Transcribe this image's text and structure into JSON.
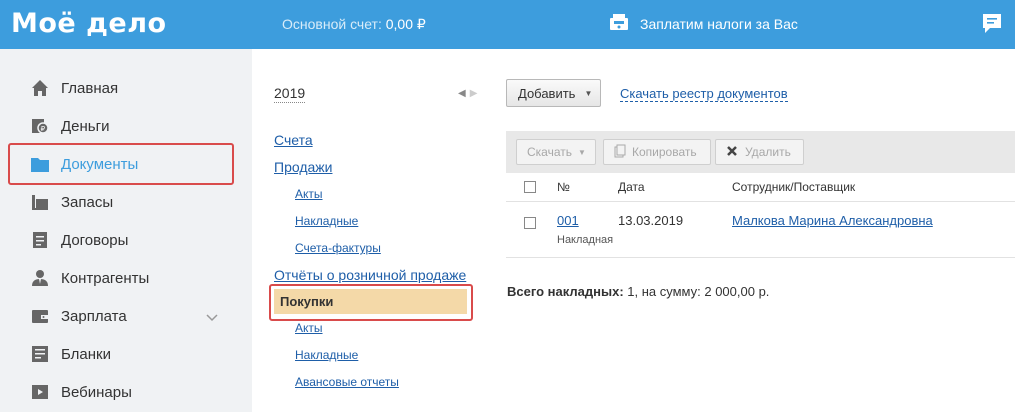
{
  "header": {
    "logo": "Моё дело",
    "account_label": "Основной счет:",
    "account_value": "0,00 ₽",
    "taxes_label": "Заплатим налоги за Вас"
  },
  "sidebar": {
    "items": [
      {
        "label": "Главная",
        "icon": "home-icon"
      },
      {
        "label": "Деньги",
        "icon": "money-icon"
      },
      {
        "label": "Документы",
        "icon": "folder-icon",
        "active": true
      },
      {
        "label": "Запасы",
        "icon": "stock-icon"
      },
      {
        "label": "Договоры",
        "icon": "contract-icon"
      },
      {
        "label": "Контрагенты",
        "icon": "contractor-icon"
      },
      {
        "label": "Зарплата",
        "icon": "wallet-icon"
      },
      {
        "label": "Бланки",
        "icon": "forms-icon"
      },
      {
        "label": "Вебинары",
        "icon": "webinar-icon"
      }
    ]
  },
  "tree": {
    "year": "2019",
    "items": {
      "invoices": "Счета",
      "sales": "Продажи",
      "sales_acts": "Акты",
      "sales_waybills": "Накладные",
      "sales_invoices": "Счета-фактуры",
      "retail_reports": "Отчёты о розничной продаже",
      "purchases": "Покупки",
      "purchase_acts": "Акты",
      "purchase_waybills": "Накладные",
      "advance_reports": "Авансовые отчеты"
    }
  },
  "toolbar": {
    "add_label": "Добавить",
    "download_registry": "Скачать реестр документов",
    "download_label": "Скачать",
    "copy_label": "Копировать",
    "delete_label": "Удалить"
  },
  "table": {
    "headers": {
      "number": "№",
      "date": "Дата",
      "employee": "Сотрудник/Поставщик"
    },
    "rows": [
      {
        "number": "001",
        "type": "Накладная",
        "date": "13.03.2019",
        "supplier": "Малкова Марина Александровна"
      }
    ]
  },
  "summary": {
    "label": "Всего накладных:",
    "text": "1, на сумму: 2 000,00 р."
  },
  "colors": {
    "header": "#3d9ddd",
    "link": "#1e5ea8",
    "highlight": "#d94b4b",
    "active_bg": "#f4d9a8"
  }
}
